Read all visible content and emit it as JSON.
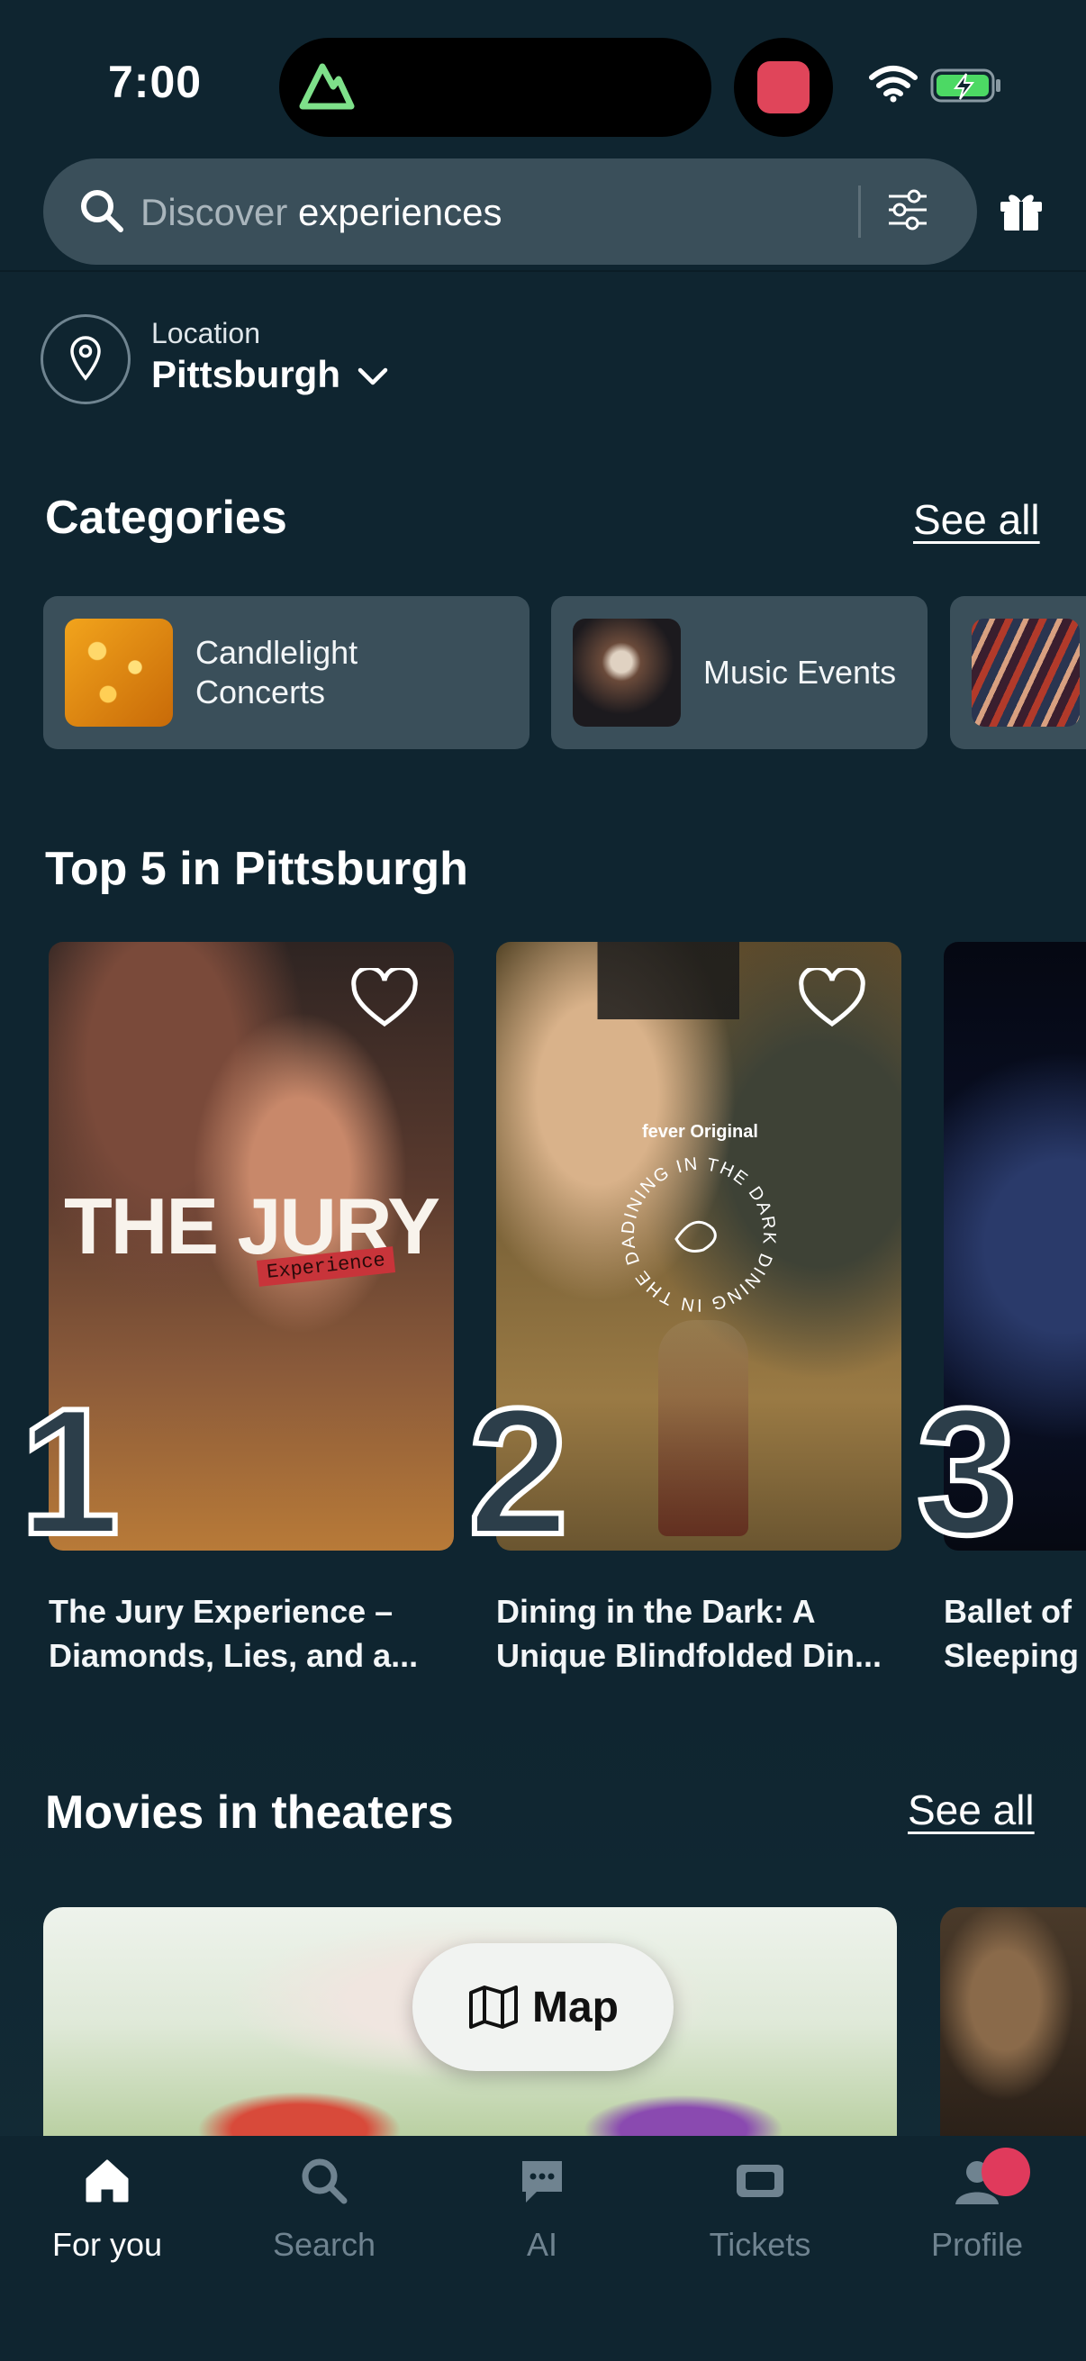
{
  "status_bar": {
    "time": "7:00"
  },
  "search": {
    "placeholder_word": "Discover",
    "typed_word": "experiences",
    "icon": "search-icon",
    "filter_icon": "sliders-icon",
    "gift_icon": "gift-icon"
  },
  "location": {
    "label": "Location",
    "value": "Pittsburgh"
  },
  "categories": {
    "title": "Categories",
    "see_all": "See all",
    "items": [
      {
        "label": "Candlelight Concerts"
      },
      {
        "label": "Music Events"
      }
    ]
  },
  "top5": {
    "title": "Top 5 in Pittsburgh",
    "items": [
      {
        "rank": "1",
        "title": "The Jury Experience – Diamonds, Lies, and a...",
        "poster_title": "THE JURY",
        "poster_sub": "Experience"
      },
      {
        "rank": "2",
        "title": "Dining in the Dark: A Unique Blindfolded Din...",
        "poster_brand": "fever Original",
        "poster_ring": "DINING IN THE DARK DINING IN THE DARK"
      },
      {
        "rank": "3",
        "title": "Ballet of Sleeping"
      }
    ]
  },
  "movies": {
    "title": "Movies in theaters",
    "see_all": "See all"
  },
  "map_button": {
    "label": "Map"
  },
  "bottom_nav": {
    "items": [
      {
        "label": "For you",
        "icon": "home-icon",
        "active": true
      },
      {
        "label": "Search",
        "icon": "search-icon"
      },
      {
        "label": "AI",
        "icon": "chat-icon"
      },
      {
        "label": "Tickets",
        "icon": "ticket-icon"
      },
      {
        "label": "Profile",
        "icon": "user-icon"
      }
    ]
  },
  "colors": {
    "background": "#0f2530",
    "surface": "#3a4f5a",
    "accent_badge": "#e03a5c"
  }
}
